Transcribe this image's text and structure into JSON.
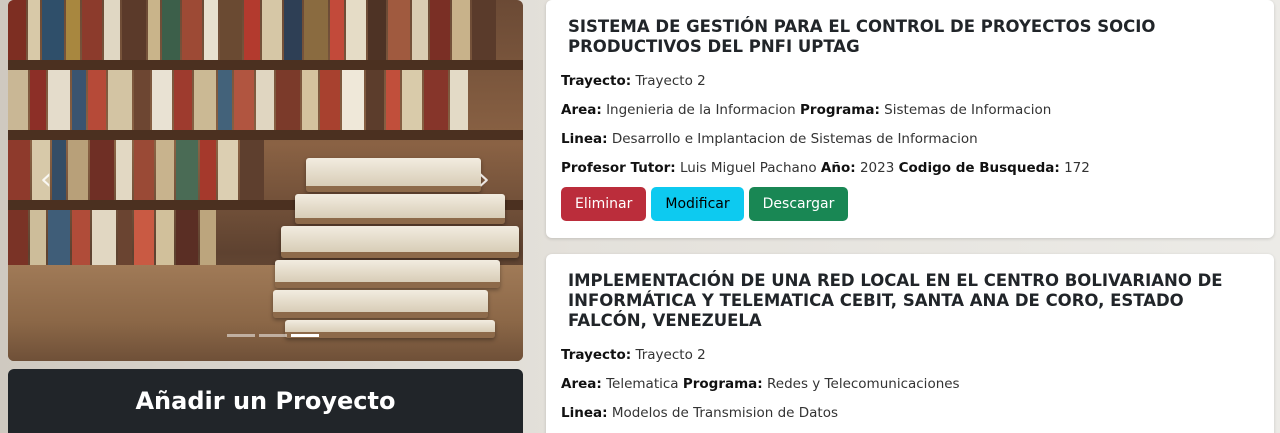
{
  "carousel": {
    "prev_icon": "‹",
    "next_icon": "›",
    "slide_count": 3,
    "active_slide": 3
  },
  "add_project_label": "Añadir un Proyecto",
  "projects": [
    {
      "title": "SISTEMA DE GESTIÓN PARA EL CONTROL DE PROYECTOS SOCIO PRODUCTIVOS DEL PNFI UPTAG",
      "trayecto_label": "Trayecto:",
      "trayecto": "Trayecto 2",
      "area_label": "Area:",
      "area": "Ingenieria de la Informacion",
      "programa_label": "Programa:",
      "programa": "Sistemas de Informacion",
      "linea_label": "Linea:",
      "linea": "Desarrollo e Implantacion de Sistemas de Informacion",
      "tutor_label": "Profesor Tutor:",
      "tutor": "Luis Miguel Pachano",
      "anio_label": "Año:",
      "anio": "2023",
      "codigo_label": "Codigo de Busqueda:",
      "codigo": "172"
    },
    {
      "title": "IMPLEMENTACIÓN DE UNA RED LOCAL EN EL CENTRO BOLIVARIANO DE INFORMÁTICA Y TELEMATICA CEBIT, SANTA ANA DE CORO, ESTADO FALCÓN, VENEZUELA",
      "trayecto_label": "Trayecto:",
      "trayecto": "Trayecto 2",
      "area_label": "Area:",
      "area": "Telematica",
      "programa_label": "Programa:",
      "programa": "Redes y Telecomunicaciones",
      "linea_label": "Linea:",
      "linea": "Modelos de Transmision de Datos"
    }
  ],
  "buttons": {
    "delete": "Eliminar",
    "edit": "Modificar",
    "download": "Descargar"
  },
  "colors": {
    "delete": "#bb2d3b",
    "edit": "#0dcaf0",
    "download": "#198754",
    "dark": "#212529"
  }
}
